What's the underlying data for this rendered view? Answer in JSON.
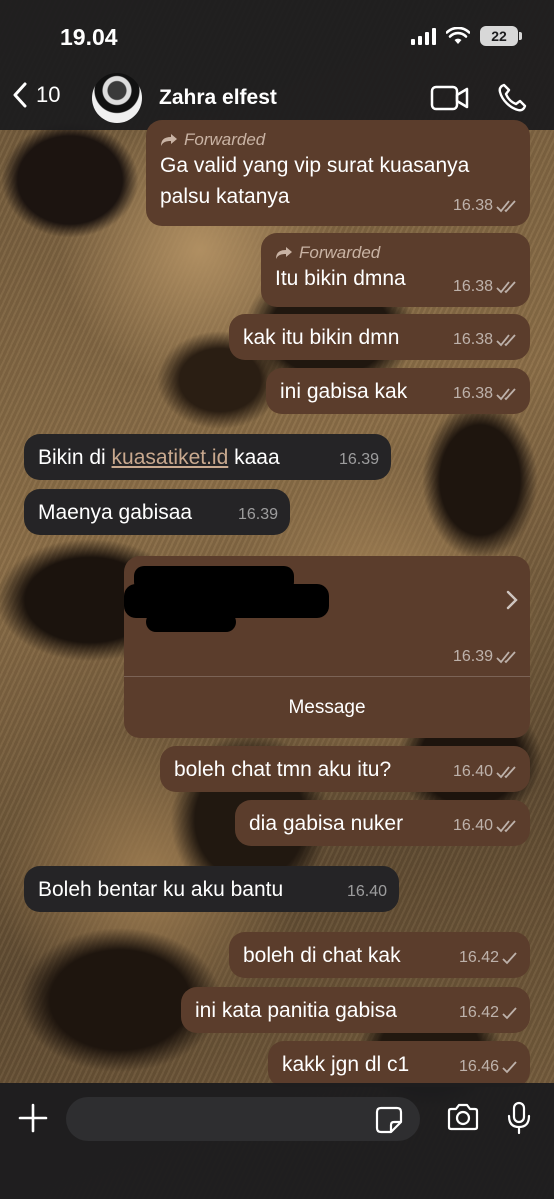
{
  "status": {
    "time": "19.04",
    "battery": "22"
  },
  "header": {
    "back_count": "10",
    "contact_name": "Zahra elfest"
  },
  "messages": [
    {
      "fwd": "Forwarded",
      "line1": "Ga valid yang vip surat kuasanya",
      "line2": "palsu katanya",
      "time": "16.38"
    },
    {
      "fwd": "Forwarded",
      "text": "Itu bikin dmna",
      "time": "16.38"
    },
    {
      "text": "kak itu bikin dmn",
      "time": "16.38"
    },
    {
      "text": "ini gabisa kak",
      "time": "16.38"
    },
    {
      "pre": "Bikin di ",
      "link": "kuasatiket.id",
      "post": " kaaa",
      "time": "16.39"
    },
    {
      "text": "Maenya gabisaa",
      "time": "16.39"
    },
    {
      "card_time": "16.39",
      "card_button": "Message"
    },
    {
      "text": "boleh chat tmn aku itu?",
      "time": "16.40"
    },
    {
      "text": "dia gabisa nuker",
      "time": "16.40"
    },
    {
      "text": "Boleh bentar ku aku bantu",
      "time": "16.40"
    },
    {
      "text": "boleh di chat kak",
      "time": "16.42"
    },
    {
      "text": "ini kata panitia gabisa",
      "time": "16.42"
    },
    {
      "text": "kakk jgn dl c1",
      "time": "16.46"
    }
  ],
  "icons": {
    "back": "chevron-left-icon",
    "video": "video-camera-icon",
    "call": "phone-icon",
    "forward": "forward-arrow-icon",
    "read": "double-check-icon",
    "sent": "single-check-icon",
    "plus": "plus-icon",
    "sticker": "sticker-icon",
    "camera": "camera-icon",
    "mic": "microphone-icon",
    "chevron": "chevron-right-icon"
  },
  "colors": {
    "outgoing_bubble": "#5b3d2c",
    "incoming_bubble": "#252426",
    "bar": "#1c1c1e"
  }
}
